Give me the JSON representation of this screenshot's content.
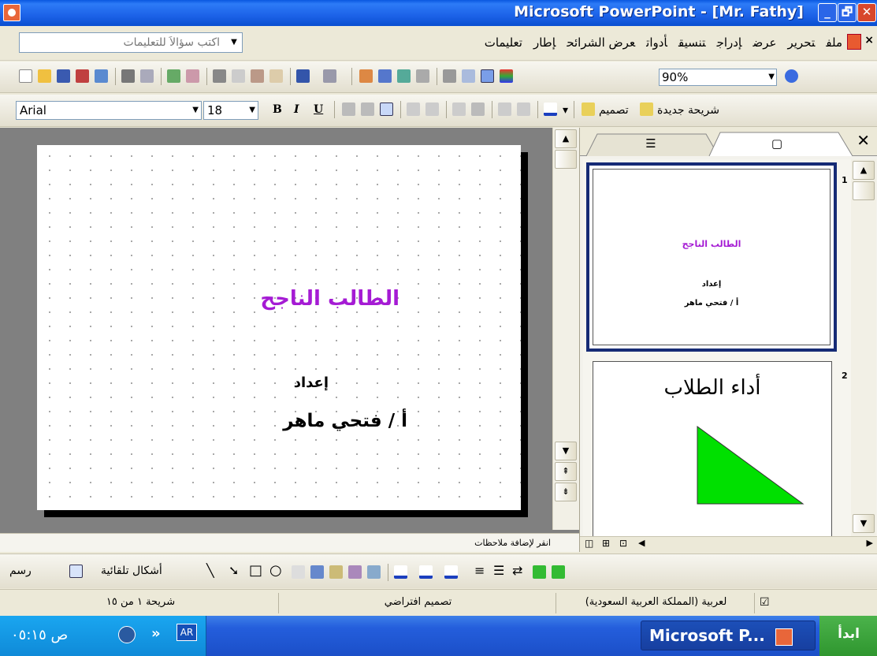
{
  "window": {
    "title": "Microsoft PowerPoint - [Mr. Fathy]",
    "minimize_label": "_",
    "maximize_label": "🗗",
    "close_label": "✕"
  },
  "menu": {
    "items": [
      "ملف",
      "تحرير",
      "عرض",
      "إدراج",
      "تنسيق",
      "أدوات",
      "عرض الشرائح",
      "إطار",
      "تعليمات"
    ],
    "help_placeholder": "اكتب سؤالاً للتعليمات",
    "close_label": "×"
  },
  "standard_toolbar": {
    "zoom": "90%"
  },
  "formatting_toolbar": {
    "font": "Arial",
    "size": "18",
    "bold": "B",
    "italic": "I",
    "underline": "U",
    "design_label": "تصميم",
    "new_slide_label": "شريحة جديدة"
  },
  "slide": {
    "title": "الطالب الناجح",
    "prepared_by": "إعداد",
    "author": "أ / فتحي ماهر"
  },
  "notes": {
    "placeholder": "انقر لإضافة ملاحظات"
  },
  "pane": {
    "close_label": "✕",
    "thumbnails": [
      {
        "number": "1",
        "title": "الطالب الناجح",
        "prepared_by": "إعداد",
        "author": "أ / فتحي ماهر"
      },
      {
        "number": "2",
        "title": "أداء الطلاب"
      }
    ]
  },
  "drawing_toolbar": {
    "drawing_label": "رسم",
    "autoshapes_label": "أشكال تلقائية"
  },
  "status": {
    "slide_count": "شريحة ١ من ١٥",
    "design": "تصميم افتراضي",
    "language": "لعربية (المملكة العربية السعودية)"
  },
  "taskbar": {
    "start_label": "ابدأ",
    "task_label": "Microsoft P...",
    "language": "AR",
    "clock": "ص ٠٥:١٥"
  },
  "colors": {
    "title_accent": "#a51bd4",
    "triangle_fill": "#00e000",
    "selection_frame": "#162b75"
  }
}
